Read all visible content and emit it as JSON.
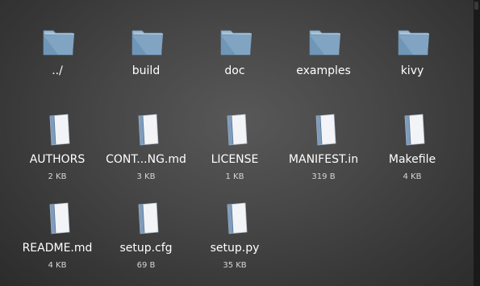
{
  "file_browser": {
    "entries": [
      {
        "name": "../",
        "size": "",
        "kind": "folder-icon"
      },
      {
        "name": "build",
        "size": "",
        "kind": "folder-icon"
      },
      {
        "name": "doc",
        "size": "",
        "kind": "folder-icon"
      },
      {
        "name": "examples",
        "size": "",
        "kind": "folder-icon"
      },
      {
        "name": "kivy",
        "size": "",
        "kind": "folder-icon"
      },
      {
        "name": "AUTHORS",
        "size": "2 KB",
        "kind": "file-icon"
      },
      {
        "name": "CONT...NG.md",
        "size": "3 KB",
        "kind": "file-icon"
      },
      {
        "name": "LICENSE",
        "size": "1 KB",
        "kind": "file-icon"
      },
      {
        "name": "MANIFEST.in",
        "size": "319 B",
        "kind": "file-icon"
      },
      {
        "name": "Makefile",
        "size": "4 KB",
        "kind": "file-icon"
      },
      {
        "name": "README.md",
        "size": "4 KB",
        "kind": "file-icon"
      },
      {
        "name": "setup.cfg",
        "size": "69 B",
        "kind": "file-icon"
      },
      {
        "name": "setup.py",
        "size": "35 KB",
        "kind": "file-icon"
      }
    ]
  },
  "colors": {
    "folder_front": "#6f95b7",
    "folder_back": "#a9c3da",
    "file_page": "#f2f4f7",
    "file_spine": "#7f9cbc"
  }
}
